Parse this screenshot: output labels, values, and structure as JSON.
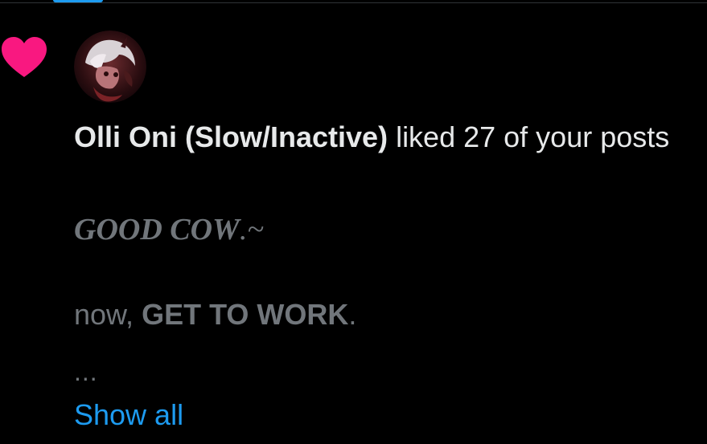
{
  "notification": {
    "type_icon": "heart-icon",
    "user_name": "Olli Oni (Slow/Inactive)",
    "action_text": " liked 27 of your posts",
    "preview": {
      "line1_bold": "GOOD COW",
      "line1_rest": ".~",
      "line2_prefix": "now, ",
      "line2_bold": "GET TO WORK",
      "line2_suffix": "."
    },
    "ellipsis": "...",
    "show_all_label": "Show all"
  },
  "colors": {
    "background": "#000000",
    "primary_text": "#e7e9ea",
    "secondary_text": "#71767b",
    "link": "#1d9bf0",
    "heart": "#f91880"
  }
}
